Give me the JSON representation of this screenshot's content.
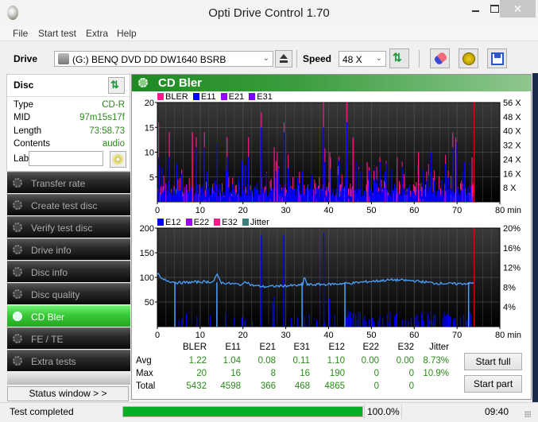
{
  "window": {
    "title": "Opti Drive Control 1.70",
    "close_glyph": "✕"
  },
  "menu": [
    "File",
    "Start test",
    "Extra",
    "Help"
  ],
  "toolbar": {
    "drive_label": "Drive",
    "drive_value": "(G:)   BENQ DVD DD DW1640 BSRB",
    "speed_label": "Speed",
    "speed_value": "48 X",
    "chevron": "⌄",
    "refresh_glyph": "⇅"
  },
  "disc": {
    "header": "Disc",
    "refresh_glyph": "⇅",
    "fields": [
      {
        "key": "Type",
        "value": "CD-R"
      },
      {
        "key": "MID",
        "value": "97m15s17f"
      },
      {
        "key": "Length",
        "value": "73:58.73"
      },
      {
        "key": "Contents",
        "value": "audio"
      }
    ],
    "label_key": "Label",
    "label_value": ""
  },
  "nav": [
    {
      "label": "Transfer rate",
      "active": false
    },
    {
      "label": "Create test disc",
      "active": false
    },
    {
      "label": "Verify test disc",
      "active": false
    },
    {
      "label": "Drive info",
      "active": false
    },
    {
      "label": "Disc info",
      "active": false
    },
    {
      "label": "Disc quality",
      "active": false
    },
    {
      "label": "CD Bler",
      "active": true
    },
    {
      "label": "FE / TE",
      "active": false
    },
    {
      "label": "Extra tests",
      "active": false
    }
  ],
  "status_window_button": "Status window > >",
  "main": {
    "title": "CD Bler"
  },
  "chart_data": [
    {
      "type": "bar",
      "title": "BLER / E11 / E21 / E31",
      "legend": [
        {
          "name": "BLER",
          "color": "#ff1a8c"
        },
        {
          "name": "E11",
          "color": "#0000ff"
        },
        {
          "name": "E21",
          "color": "#9b00ff"
        },
        {
          "name": "E31",
          "color": "#7a00ff"
        }
      ],
      "xlabel": "min",
      "xlim": [
        0,
        80
      ],
      "x_ticks": [
        "0",
        "10",
        "20",
        "30",
        "40",
        "50",
        "60",
        "70",
        "80 min"
      ],
      "ylim": [
        0,
        20
      ],
      "y_ticks": [
        "5",
        "10",
        "15",
        "20"
      ],
      "y2_ticks": [
        "8 X",
        "16 X",
        "24 X",
        "32 X",
        "40 X",
        "48 X",
        "56 X"
      ],
      "y2lim": [
        0,
        56
      ],
      "end_marker_min": 74,
      "bler_peaks": [
        [
          0.3,
          16
        ],
        [
          2.8,
          14
        ],
        [
          8.2,
          14
        ],
        [
          9.1,
          13
        ],
        [
          11.0,
          14
        ],
        [
          14.0,
          12
        ],
        [
          16.3,
          13
        ],
        [
          21.3,
          13
        ],
        [
          24.3,
          18
        ],
        [
          27.3,
          11
        ],
        [
          28.0,
          10
        ],
        [
          29.6,
          16
        ],
        [
          38.8,
          20
        ],
        [
          40.3,
          10
        ],
        [
          44.3,
          20
        ],
        [
          45.7,
          13
        ],
        [
          49.0,
          8
        ],
        [
          52.0,
          9
        ],
        [
          56.0,
          9
        ],
        [
          61.0,
          10
        ],
        [
          69.0,
          14
        ],
        [
          69.7,
          13
        ],
        [
          73.5,
          9
        ]
      ],
      "e11_peaks": [
        [
          0.3,
          9
        ],
        [
          2.8,
          9
        ],
        [
          9.1,
          11
        ],
        [
          11.0,
          11
        ],
        [
          14.0,
          12
        ],
        [
          16.3,
          9
        ],
        [
          21.3,
          9
        ],
        [
          24.3,
          15
        ],
        [
          29.6,
          14
        ],
        [
          38.8,
          15
        ],
        [
          44.3,
          16
        ],
        [
          52.0,
          8
        ],
        [
          64.0,
          10
        ],
        [
          69.0,
          11
        ],
        [
          70.0,
          12
        ]
      ],
      "e11_baseline": 2
    },
    {
      "type": "bar",
      "title": "E12 / E22 / E32 / Jitter",
      "legend": [
        {
          "name": "E12",
          "color": "#0000ff"
        },
        {
          "name": "E22",
          "color": "#9b00ff"
        },
        {
          "name": "E32",
          "color": "#ff1a8c"
        },
        {
          "name": "Jitter",
          "color": "#3a8080"
        }
      ],
      "xlabel": "min",
      "xlim": [
        0,
        80
      ],
      "x_ticks": [
        "0",
        "10",
        "20",
        "30",
        "40",
        "50",
        "60",
        "70",
        "80 min"
      ],
      "ylim": [
        0,
        200
      ],
      "y_ticks": [
        "50",
        "100",
        "150",
        "200"
      ],
      "y2_ticks": [
        "4%",
        "8%",
        "12%",
        "16%",
        "20%"
      ],
      "y2lim": [
        0,
        20
      ],
      "end_marker_min": 74,
      "e12_peaks": [
        [
          24.3,
          185
        ],
        [
          29.5,
          186
        ],
        [
          38.9,
          190
        ],
        [
          40.2,
          57
        ],
        [
          27.3,
          60
        ],
        [
          27.0,
          48
        ],
        [
          44.5,
          33
        ],
        [
          45.0,
          30
        ]
      ],
      "jitter_line_pct": [
        [
          0,
          10.9
        ],
        [
          1,
          9.6
        ],
        [
          3,
          9.2
        ],
        [
          5,
          8.9
        ],
        [
          10,
          9.1
        ],
        [
          13,
          9.1
        ],
        [
          14,
          10.5
        ],
        [
          15,
          8.9
        ],
        [
          20,
          8.5
        ],
        [
          20.5,
          9.3
        ],
        [
          22,
          8.4
        ],
        [
          25,
          8.1
        ],
        [
          30,
          8.3
        ],
        [
          34,
          8.4
        ],
        [
          34.3,
          10.3
        ],
        [
          35,
          8.5
        ],
        [
          40,
          8.6
        ],
        [
          45,
          8.8
        ],
        [
          50,
          9.2
        ],
        [
          55,
          9.5
        ],
        [
          60,
          9.3
        ],
        [
          65,
          8.8
        ],
        [
          70,
          8.7
        ],
        [
          74,
          8.8
        ]
      ],
      "jitter_dips_min": [
        4.1,
        13.9,
        33.8,
        43.8,
        72.7
      ]
    }
  ],
  "stats": {
    "columns": [
      "BLER",
      "E11",
      "E21",
      "E31",
      "E12",
      "E22",
      "E32",
      "Jitter"
    ],
    "rows": [
      {
        "label": "Avg",
        "values": [
          "1.22",
          "1.04",
          "0.08",
          "0.11",
          "1.10",
          "0.00",
          "0.00",
          "8.73%"
        ]
      },
      {
        "label": "Max",
        "values": [
          "20",
          "16",
          "8",
          "16",
          "190",
          "0",
          "0",
          "10.9%"
        ]
      },
      {
        "label": "Total",
        "values": [
          "5432",
          "4598",
          "366",
          "468",
          "4865",
          "0",
          "0",
          ""
        ]
      }
    ]
  },
  "buttons": {
    "start_full": "Start full",
    "start_part": "Start part"
  },
  "statusbar": {
    "text": "Test completed",
    "progress": 1.0,
    "progress_text": "100.0%",
    "time": "09:40"
  }
}
